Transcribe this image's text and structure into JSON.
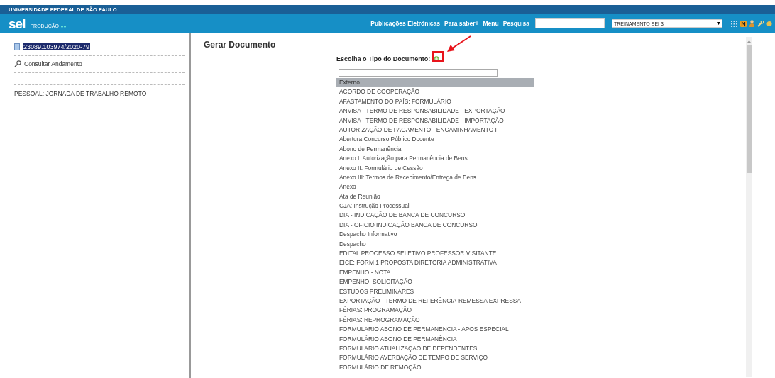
{
  "header": {
    "institution": "UNIVERSIDADE FEDERAL DE SÃO PAULO",
    "logo": "sei",
    "environment": "PRODUÇÃO",
    "nav": [
      "Publicações Eletrônicas",
      "Para saber+",
      "Menu",
      "Pesquisa"
    ],
    "unit_select": "TREINAMENTO SEI 3"
  },
  "sidebar": {
    "process_number": "23089.103974/2020-79",
    "process_selected": true,
    "action": "Consultar Andamento",
    "process_type": "PESSOAL: JORNADA DE TRABALHO REMOTO"
  },
  "main": {
    "title": "Gerar Documento",
    "prompt": "Escolha o Tipo do Documento:",
    "annotation": {
      "highlighted": true
    },
    "document_types": [
      {
        "label": "Externo",
        "selected": true
      },
      {
        "label": "ACORDO DE COOPERAÇÃO",
        "selected": false
      },
      {
        "label": "AFASTAMENTO DO PAÍS: FORMULÁRIO",
        "selected": false
      },
      {
        "label": "ANVISA - TERMO DE RESPONSABILIDADE - EXPORTAÇÃO",
        "selected": false
      },
      {
        "label": "ANVISA - TERMO DE RESPONSABILIDADE - IMPORTAÇÃO",
        "selected": false
      },
      {
        "label": "AUTORIZAÇÃO DE PAGAMENTO - ENCAMINHAMENTO I",
        "selected": false
      },
      {
        "label": "Abertura Concurso Público Docente",
        "selected": false
      },
      {
        "label": "Abono de Permanência",
        "selected": false
      },
      {
        "label": "Anexo I: Autorização para Permanência de Bens",
        "selected": false
      },
      {
        "label": "Anexo II: Formulário de Cessão",
        "selected": false
      },
      {
        "label": "Anexo III: Termos de Recebimento/Entrega de Bens",
        "selected": false
      },
      {
        "label": "Anexo",
        "selected": false
      },
      {
        "label": "Ata de Reunião",
        "selected": false
      },
      {
        "label": "CJA: Instrução Processual",
        "selected": false
      },
      {
        "label": "DIA - INDICAÇÃO DE BANCA DE CONCURSO",
        "selected": false
      },
      {
        "label": "DIA - OFICIO INDICAÇÃO BANCA DE CONCURSO",
        "selected": false
      },
      {
        "label": "Despacho Informativo",
        "selected": false
      },
      {
        "label": "Despacho",
        "selected": false
      },
      {
        "label": "EDITAL PROCESSO SELETIVO PROFESSOR VISITANTE",
        "selected": false
      },
      {
        "label": "EICE: FORM 1 PROPOSTA DIRETORIA ADMINISTRATIVA",
        "selected": false
      },
      {
        "label": "EMPENHO - NOTA",
        "selected": false
      },
      {
        "label": "EMPENHO: SOLICITAÇÃO",
        "selected": false
      },
      {
        "label": "ESTUDOS PRELIMINARES",
        "selected": false
      },
      {
        "label": "EXPORTAÇÃO - TERMO DE REFERÊNCIA-REMESSA EXPRESSA",
        "selected": false
      },
      {
        "label": "FÉRIAS: PROGRAMAÇÃO",
        "selected": false
      },
      {
        "label": "FÉRIAS: REPROGRAMAÇÃO",
        "selected": false
      },
      {
        "label": "FORMULÁRIO ABONO DE PERMANÊNCIA - APOS ESPECIAL",
        "selected": false
      },
      {
        "label": "FORMULÁRIO ABONO DE PERMANÊNCIA",
        "selected": false
      },
      {
        "label": "FORMULÁRIO ATUALIZAÇÃO DE DEPENDENTES",
        "selected": false
      },
      {
        "label": "FORMULÁRIO AVERBAÇÃO DE TEMPO DE SERVIÇO",
        "selected": false
      },
      {
        "label": "FORMULÁRIO DE REMOÇÃO",
        "selected": false
      }
    ]
  }
}
